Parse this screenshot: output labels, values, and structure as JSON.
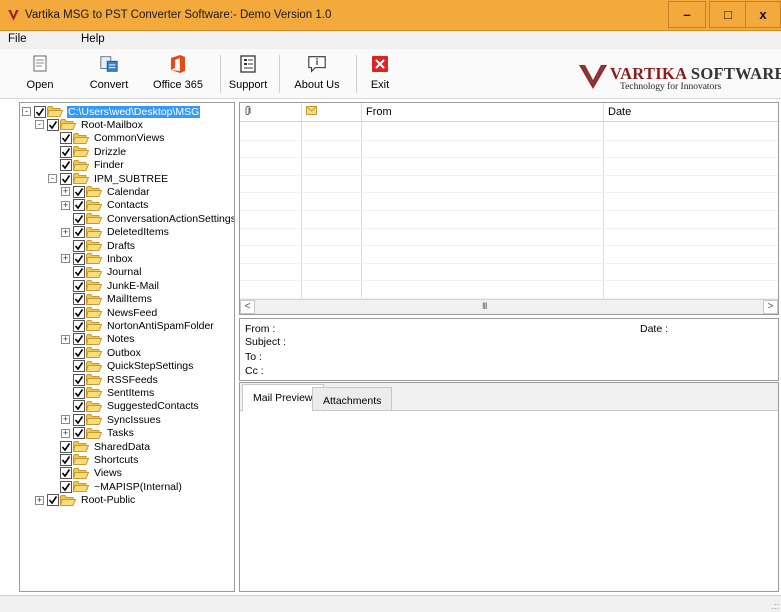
{
  "window": {
    "title": "Vartika MSG to PST Converter Software:- Demo Version 1.0",
    "controls": {
      "minimize": "–",
      "maximize": "□",
      "close": "x"
    }
  },
  "menu": {
    "file": "File",
    "help": "Help"
  },
  "toolbar": {
    "open": "Open",
    "convert": "Convert",
    "office365": "Office 365",
    "support": "Support",
    "about": "About Us",
    "exit": "Exit"
  },
  "brand": {
    "name_a": "VARTIKA",
    "name_b": "SOFTWARE",
    "tagline": "Technology for Innovators"
  },
  "tree": {
    "root": "C:\\Users\\wed\\Desktop\\MSG",
    "nodes": [
      "Root-Mailbox",
      "CommonViews",
      "Drizzle",
      "Finder",
      "IPM_SUBTREE",
      "Calendar",
      "Contacts",
      "ConversationActionSettings",
      "DeletedItems",
      "Drafts",
      "Inbox",
      "Journal",
      "JunkE-Mail",
      "MailItems",
      "NewsFeed",
      "NortonAntiSpamFolder",
      "Notes",
      "Outbox",
      "QuickStepSettings",
      "RSSFeeds",
      "SentItems",
      "SuggestedContacts",
      "SyncIssues",
      "Tasks",
      "SharedData",
      "Shortcuts",
      "Views",
      "~MAPISP(Internal)",
      "Root-Public"
    ]
  },
  "mail_list": {
    "columns": {
      "attach": "",
      "icon": "",
      "from": "From",
      "date": "Date"
    },
    "scroll_grip": "III"
  },
  "details": {
    "from": "From :",
    "date": "Date :",
    "subject": "Subject :",
    "to": "To :",
    "cc": "Cc :"
  },
  "tabs": {
    "preview": "Mail Preview",
    "attachments": "Attachments"
  }
}
